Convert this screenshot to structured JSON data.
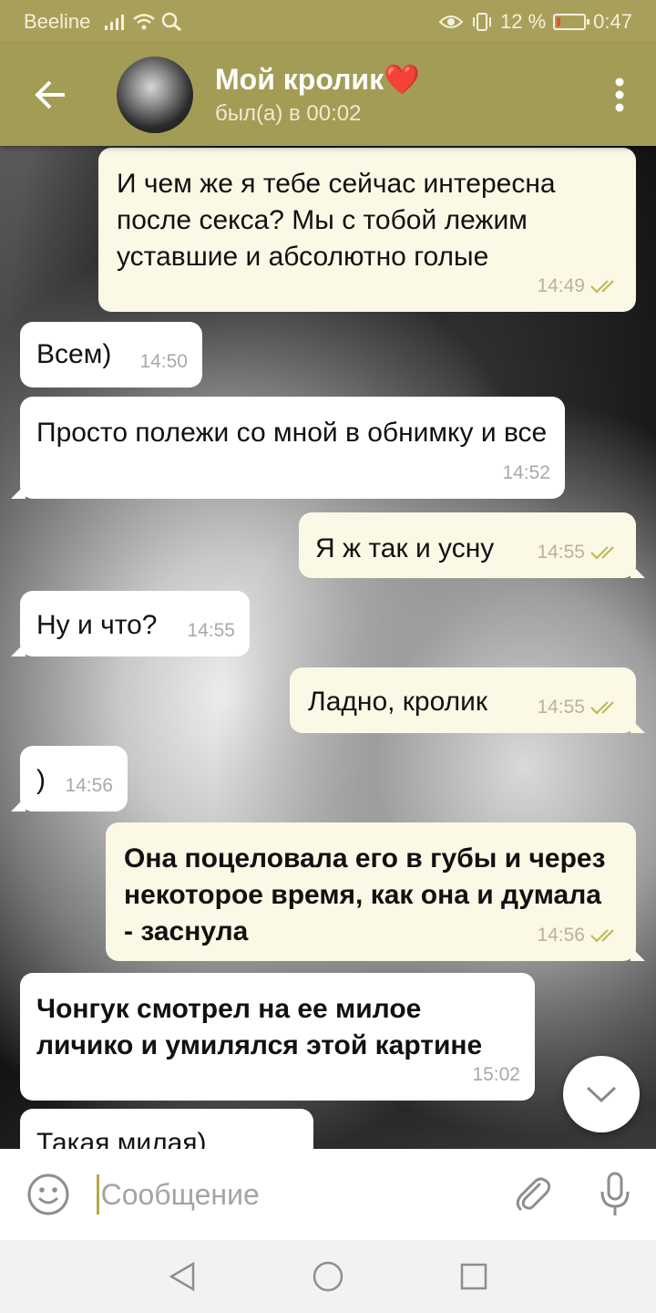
{
  "status_bar": {
    "carrier": "Beeline",
    "battery_percent_label": "12 %",
    "battery_level": 0.12,
    "time": "0:47"
  },
  "header": {
    "title": "Мой кролик",
    "title_emoji": "❤️",
    "status": "был(а) в 00:02",
    "accent_color": "#a39c55"
  },
  "messages": [
    {
      "dir": "out",
      "text": "И чем же я тебе сейчас интересна после секса? Мы с тобой лежим уставшие и абсолютно голые",
      "time": "14:49",
      "read": true
    },
    {
      "dir": "in",
      "text": "Всем)",
      "time": "14:50"
    },
    {
      "dir": "in",
      "text": "Просто полежи со мной в обнимку и все",
      "time": "14:52"
    },
    {
      "dir": "out",
      "text": "Я ж так и усну",
      "time": "14:55",
      "read": true
    },
    {
      "dir": "in",
      "text": "Ну и что?",
      "time": "14:55"
    },
    {
      "dir": "out",
      "text": "Ладно, кролик",
      "time": "14:55",
      "read": true
    },
    {
      "dir": "in",
      "text": ")",
      "time": "14:56"
    },
    {
      "dir": "out",
      "text": "Она поцеловала его в губы и через некоторое время, как она и думала - заснула",
      "time": "14:56",
      "read": true,
      "bold": true
    },
    {
      "dir": "in",
      "text": "Чонгук смотрел на ее милое личико и умилялся этой картине",
      "time": "15:02",
      "bold": true
    },
    {
      "dir": "in",
      "text": "Такая милая)",
      "time": ""
    }
  ],
  "composer": {
    "placeholder": "Сообщение",
    "value": ""
  },
  "icons": {
    "back": "arrow-left-icon",
    "menu": "more-vertical-icon",
    "emoji": "smile-icon",
    "attach": "paperclip-icon",
    "mic": "microphone-icon",
    "scroll_down": "chevron-down-icon",
    "read_receipt": "double-check-icon",
    "nav_back": "triangle-back-icon",
    "nav_home": "circle-home-icon",
    "nav_recents": "square-recents-icon"
  }
}
